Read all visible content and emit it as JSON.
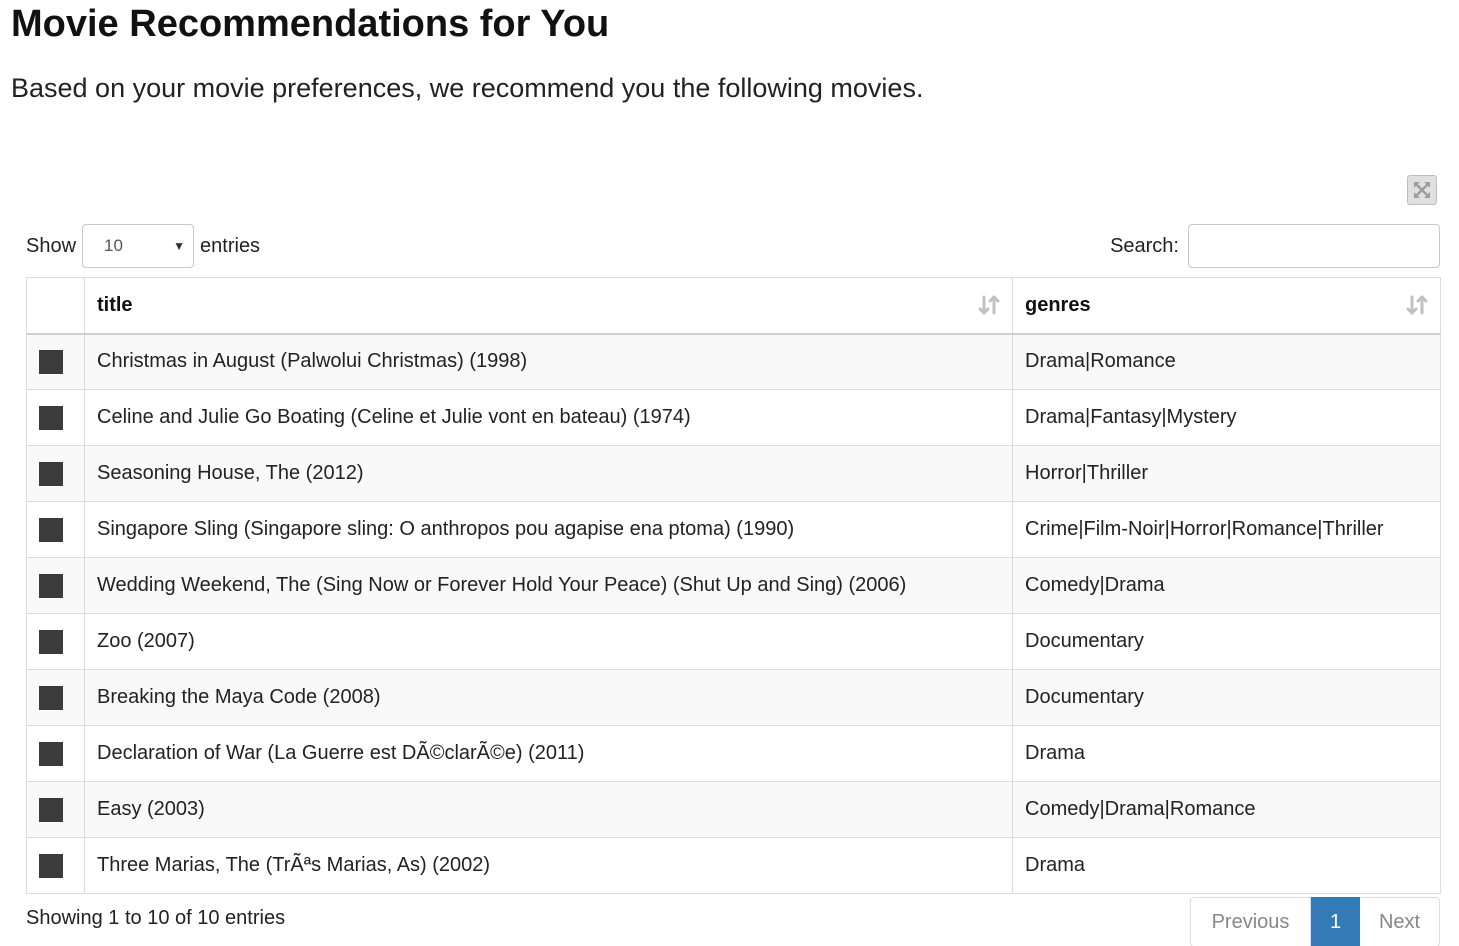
{
  "page": {
    "title": "Movie Recommendations for You",
    "subtitle": "Based on your movie preferences, we recommend you the following movies."
  },
  "controls": {
    "show_label": "Show",
    "entries_label": "entries",
    "length_value": "10",
    "search_label": "Search:",
    "search_value": ""
  },
  "table": {
    "columns": [
      "",
      "title",
      "genres"
    ],
    "rows": [
      {
        "title": "Christmas in August (Palwolui Christmas) (1998)",
        "genres": "Drama|Romance"
      },
      {
        "title": "Celine and Julie Go Boating (Celine et Julie vont en bateau) (1974)",
        "genres": "Drama|Fantasy|Mystery"
      },
      {
        "title": "Seasoning House, The (2012)",
        "genres": "Horror|Thriller"
      },
      {
        "title": "Singapore Sling (Singapore sling: O anthropos pou agapise ena ptoma) (1990)",
        "genres": "Crime|Film-Noir|Horror|Romance|Thriller"
      },
      {
        "title": "Wedding Weekend, The (Sing Now or Forever Hold Your Peace) (Shut Up and Sing) (2006)",
        "genres": "Comedy|Drama"
      },
      {
        "title": "Zoo (2007)",
        "genres": "Documentary"
      },
      {
        "title": "Breaking the Maya Code (2008)",
        "genres": "Documentary"
      },
      {
        "title": "Declaration of War (La Guerre est DÃ©clarÃ©e) (2011)",
        "genres": "Drama"
      },
      {
        "title": "Easy (2003)",
        "genres": "Comedy|Drama|Romance"
      },
      {
        "title": "Three Marias, The (TrÃªs Marias, As) (2002)",
        "genres": "Drama"
      }
    ]
  },
  "footer": {
    "info": "Showing 1 to 10 of 10 entries",
    "previous_label": "Previous",
    "current_page": "1",
    "next_label": "Next"
  },
  "colors": {
    "accent": "#337ab7",
    "row_marker": "#3b3b3b"
  },
  "icons": {
    "fullscreen": "expand-arrows-icon",
    "sort": "sort-both-icon",
    "select_caret": "caret-down-icon"
  }
}
